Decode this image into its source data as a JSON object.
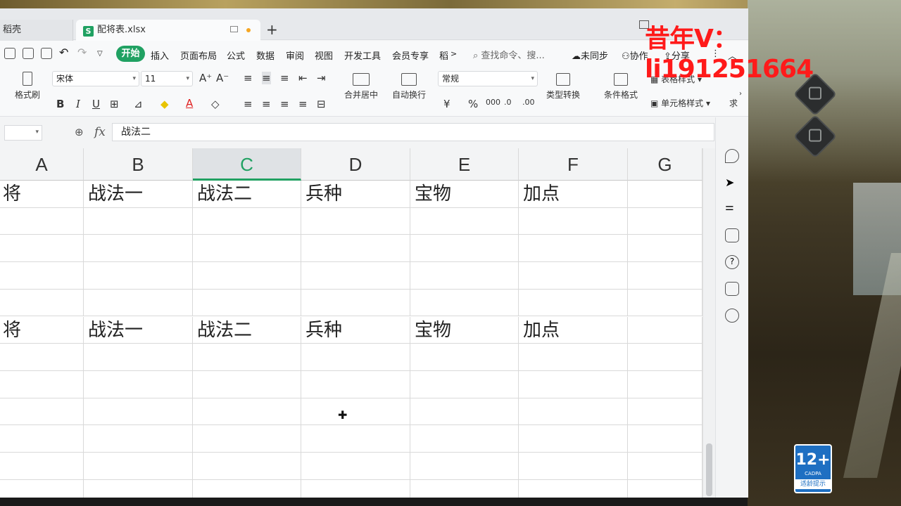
{
  "tabs": {
    "previous": "稻壳",
    "active": "配将表.xlsx",
    "file_icon": "S"
  },
  "menu": {
    "start": "开始",
    "items": [
      "插入",
      "页面布局",
      "公式",
      "数据",
      "审阅",
      "视图",
      "开发工具",
      "会员专享",
      "稻"
    ],
    "search": "查找命令、搜...",
    "sync": "未同步",
    "collab": "协作",
    "share": "分享"
  },
  "ribbon": {
    "format_painter": "格式刷",
    "font_name": "宋体",
    "font_size": "11",
    "merge_center": "合并居中",
    "wrap_text": "自动换行",
    "number_format": "常规",
    "type_convert": "类型转换",
    "conditional_format": "条件格式",
    "table_style": "表格样式",
    "cell_style": "单元格样式",
    "more": "求"
  },
  "formula": {
    "fx": "fx",
    "content": "战法二"
  },
  "columns": [
    "A",
    "B",
    "C",
    "D",
    "E",
    "F",
    "G"
  ],
  "selected_column": "C",
  "rows": [
    [
      "将",
      "战法一",
      "战法二",
      "兵种",
      "宝物",
      "加点",
      ""
    ],
    [
      "",
      "",
      "",
      "",
      "",
      "",
      ""
    ],
    [
      "",
      "",
      "",
      "",
      "",
      "",
      ""
    ],
    [
      "",
      "",
      "",
      "",
      "",
      "",
      ""
    ],
    [
      "",
      "",
      "",
      "",
      "",
      "",
      ""
    ],
    [
      "将",
      "战法一",
      "战法二",
      "兵种",
      "宝物",
      "加点",
      ""
    ],
    [
      "",
      "",
      "",
      "",
      "",
      "",
      ""
    ],
    [
      "",
      "",
      "",
      "",
      "",
      "",
      ""
    ],
    [
      "",
      "",
      "",
      "",
      "",
      "",
      ""
    ],
    [
      "",
      "",
      "",
      "",
      "",
      "",
      ""
    ],
    [
      "",
      "",
      "",
      "",
      "",
      "",
      ""
    ],
    [
      "",
      "",
      "",
      "",
      "",
      "",
      ""
    ]
  ],
  "overlay": {
    "watermark": "昔年V：li191251664",
    "age_rating": "12+",
    "age_org": "CADPA",
    "age_tip": "适龄提示"
  },
  "colors": {
    "accent": "#20a162",
    "watermark": "#ff1a1a"
  }
}
